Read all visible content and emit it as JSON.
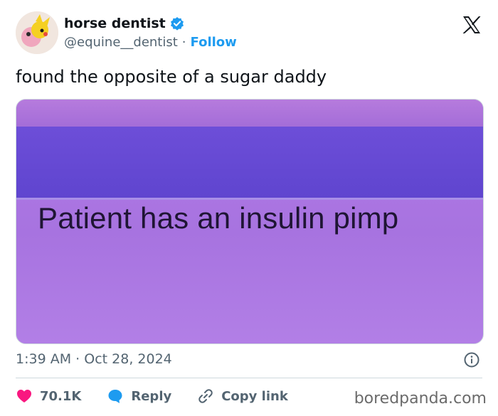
{
  "header": {
    "display_name": "horse dentist",
    "handle": "@equine__dentist",
    "separator": "·",
    "follow_label": "Follow"
  },
  "tweet": {
    "text": "found the opposite of a sugar daddy",
    "image_caption": "Patient has an insulin pimp",
    "time": "1:39 AM",
    "date": "Oct 28, 2024",
    "meta_separator": "·"
  },
  "actions": {
    "likes": "70.1K",
    "reply_label": "Reply",
    "copy_label": "Copy link"
  },
  "watermark": "boredpanda.com",
  "colors": {
    "accent": "#1d9bf0",
    "like": "#f91880",
    "text": "#0f1419",
    "muted": "#536471"
  }
}
